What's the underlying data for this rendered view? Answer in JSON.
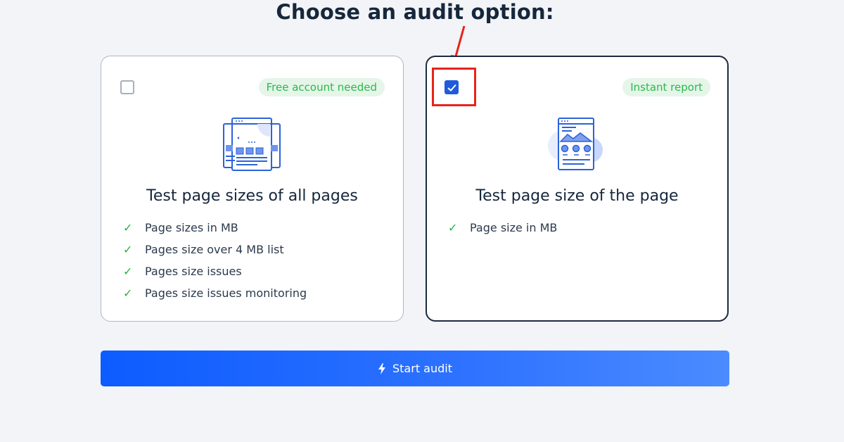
{
  "heading": "Choose an audit option:",
  "options": [
    {
      "checked": false,
      "badge": "Free account needed",
      "title": "Test page sizes of all pages",
      "features": [
        "Page sizes in MB",
        "Pages size over 4 MB list",
        "Pages size issues",
        "Pages size issues monitoring"
      ]
    },
    {
      "checked": true,
      "badge": "Instant report",
      "title": "Test page size of the page",
      "features": [
        "Page size in MB"
      ]
    }
  ],
  "start_button": {
    "label": "Start audit",
    "icon": "lightning-icon"
  },
  "colors": {
    "accent": "#1f5bdc",
    "badge_text": "#2bb84c",
    "badge_bg": "#e5f6e9",
    "annotation": "#e8231a"
  }
}
